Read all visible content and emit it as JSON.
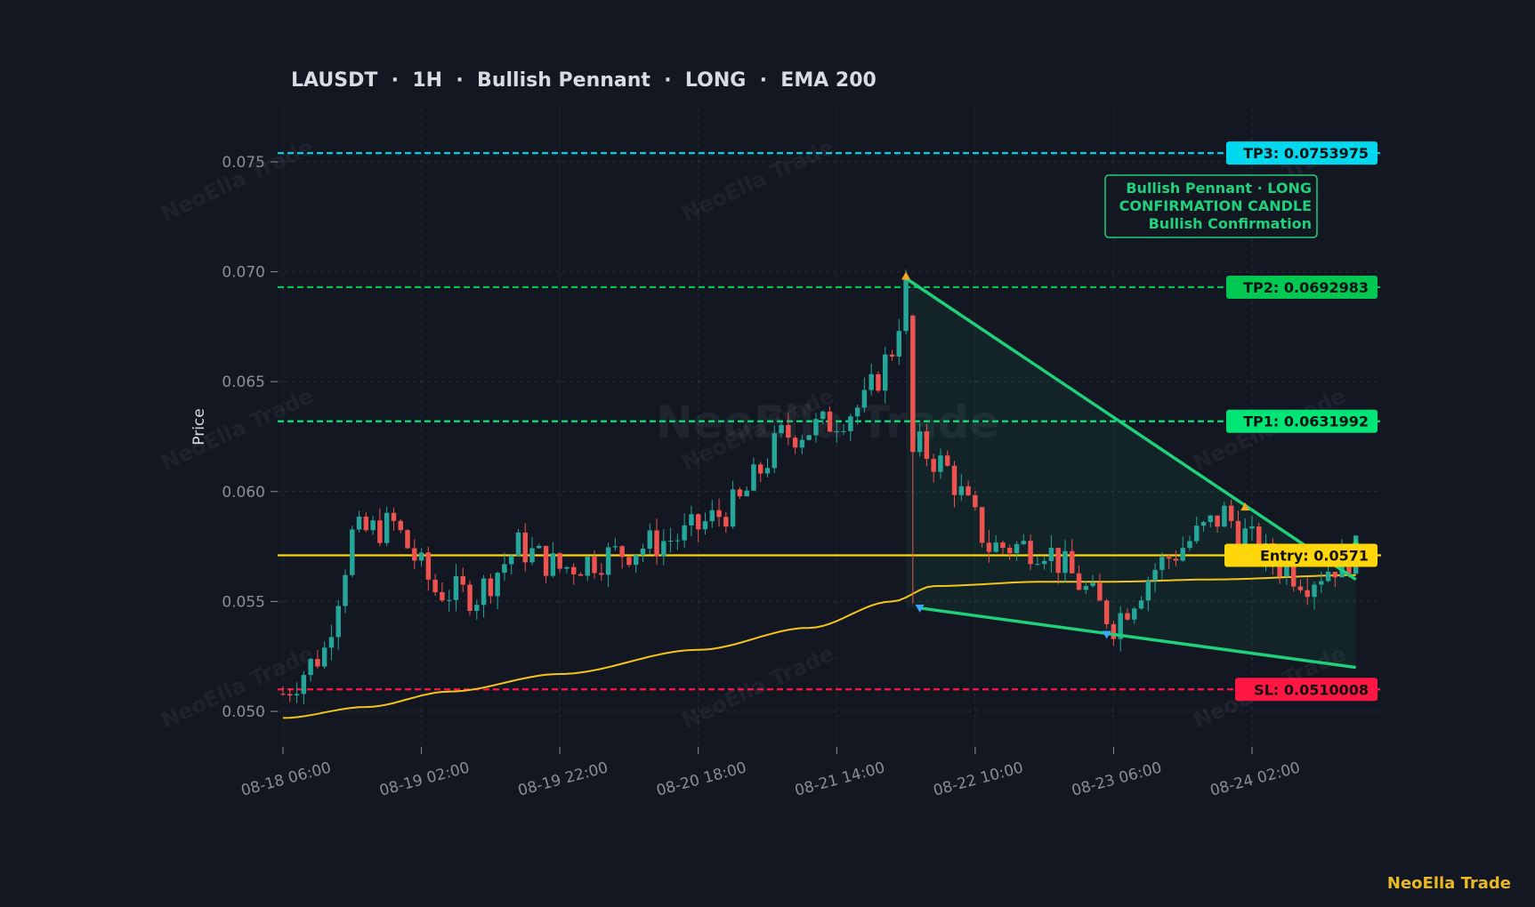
{
  "title": "LAUSDT  ·  1H  ·  Bullish Pennant  ·  LONG  ·  EMA 200",
  "brand": "NeoElla Trade",
  "watermark": "NeoElla Trade",
  "colors": {
    "background": "#131722",
    "grid": "#2a2e39",
    "bull": "#26a69a",
    "bear": "#ef5350",
    "ema": "#f5c518",
    "pattern": "#1fd17a",
    "tp1": "#00e676",
    "tp2": "#00c853",
    "tp3": "#00d8f0",
    "sl": "#ff1744",
    "entry": "#ffd60a",
    "brand": "#e8b923",
    "axis_text": "#8a8e99",
    "title_text": "#d8dbe2"
  },
  "chart_data": {
    "type": "candlestick",
    "title": "LAUSDT  ·  1H  ·  Bullish Pennant  ·  LONG  ·  EMA 200",
    "ylabel": "Price",
    "xlabel": "",
    "ylim": [
      0.0485,
      0.0773
    ],
    "x_start": "08-18 06:00",
    "x_end": "08-24 17:00",
    "interval": "1H",
    "grid": true,
    "x_ticks": [
      "08-18 06:00",
      "08-19 02:00",
      "08-19 22:00",
      "08-20 18:00",
      "08-21 14:00",
      "08-22 10:00",
      "08-23 06:00",
      "08-24 02:00"
    ],
    "y_ticks": [
      "0.050",
      "0.055",
      "0.060",
      "0.065",
      "0.070",
      "0.075"
    ],
    "price_keyframes": [
      {
        "t": "08-18 06:00",
        "p": 0.0508
      },
      {
        "t": "08-18 12:00",
        "p": 0.0528
      },
      {
        "t": "08-18 16:00",
        "p": 0.058
      },
      {
        "t": "08-18 22:00",
        "p": 0.0585
      },
      {
        "t": "08-19 04:00",
        "p": 0.0555
      },
      {
        "t": "08-19 10:00",
        "p": 0.0553
      },
      {
        "t": "08-19 16:00",
        "p": 0.0575
      },
      {
        "t": "08-19 22:00",
        "p": 0.0565
      },
      {
        "t": "08-20 04:00",
        "p": 0.057
      },
      {
        "t": "08-20 10:00",
        "p": 0.0575
      },
      {
        "t": "08-20 16:00",
        "p": 0.058
      },
      {
        "t": "08-21 00:00",
        "p": 0.0595
      },
      {
        "t": "08-21 06:00",
        "p": 0.0625
      },
      {
        "t": "08-21 12:00",
        "p": 0.063
      },
      {
        "t": "08-21 18:00",
        "p": 0.064
      },
      {
        "t": "08-21 22:00",
        "p": 0.0665
      },
      {
        "t": "08-22 00:00",
        "p": 0.0692
      },
      {
        "t": "08-22 02:00",
        "p": 0.062
      },
      {
        "t": "08-22 06:00",
        "p": 0.061
      },
      {
        "t": "08-22 12:00",
        "p": 0.0575
      },
      {
        "t": "08-22 20:00",
        "p": 0.0575
      },
      {
        "t": "08-23 02:00",
        "p": 0.0555
      },
      {
        "t": "08-23 06:00",
        "p": 0.054
      },
      {
        "t": "08-23 12:00",
        "p": 0.0565
      },
      {
        "t": "08-23 18:00",
        "p": 0.058
      },
      {
        "t": "08-23 22:00",
        "p": 0.059
      },
      {
        "t": "08-24 04:00",
        "p": 0.057
      },
      {
        "t": "08-24 10:00",
        "p": 0.056
      },
      {
        "t": "08-24 17:00",
        "p": 0.0572
      }
    ],
    "ema_200": [
      {
        "t": "08-18 06:00",
        "p": 0.0497
      },
      {
        "t": "08-18 18:00",
        "p": 0.0502
      },
      {
        "t": "08-19 06:00",
        "p": 0.0509
      },
      {
        "t": "08-19 22:00",
        "p": 0.0517
      },
      {
        "t": "08-20 18:00",
        "p": 0.0528
      },
      {
        "t": "08-21 10:00",
        "p": 0.0538
      },
      {
        "t": "08-21 22:00",
        "p": 0.055
      },
      {
        "t": "08-22 04:00",
        "p": 0.0557
      },
      {
        "t": "08-22 20:00",
        "p": 0.0559
      },
      {
        "t": "08-23 06:00",
        "p": 0.0559
      },
      {
        "t": "08-23 20:00",
        "p": 0.056
      },
      {
        "t": "08-24 17:00",
        "p": 0.0562
      }
    ],
    "levels": [
      {
        "id": "tp3",
        "label": "TP3: 0.0753975",
        "value": 0.0753975,
        "style": "dashed"
      },
      {
        "id": "tp2",
        "label": "TP2: 0.0692983",
        "value": 0.0692983,
        "style": "dashed"
      },
      {
        "id": "tp1",
        "label": "TP1: 0.0631992",
        "value": 0.0631992,
        "style": "dashed"
      },
      {
        "id": "entry",
        "label": "Entry: 0.0571",
        "value": 0.0571,
        "style": "solid"
      },
      {
        "id": "sl",
        "label": "SL: 0.0510008",
        "value": 0.0510008,
        "style": "dashed"
      }
    ],
    "pennant": {
      "upper": [
        {
          "t": "08-22 00:00",
          "p": 0.0697
        },
        {
          "t": "08-24 17:00",
          "p": 0.056
        }
      ],
      "lower": [
        {
          "t": "08-22 02:00",
          "p": 0.0547
        },
        {
          "t": "08-24 17:00",
          "p": 0.052
        }
      ]
    },
    "pivots": [
      {
        "t": "08-22 00:00",
        "p": 0.0698,
        "kind": "high"
      },
      {
        "t": "08-22 02:00",
        "p": 0.0547,
        "kind": "low"
      },
      {
        "t": "08-23 05:00",
        "p": 0.0535,
        "kind": "low"
      },
      {
        "t": "08-24 01:00",
        "p": 0.0593,
        "kind": "high"
      }
    ],
    "annotation": [
      "Bullish Pennant · LONG",
      "CONFIRMATION CANDLE",
      "Bullish Confirmation"
    ]
  }
}
